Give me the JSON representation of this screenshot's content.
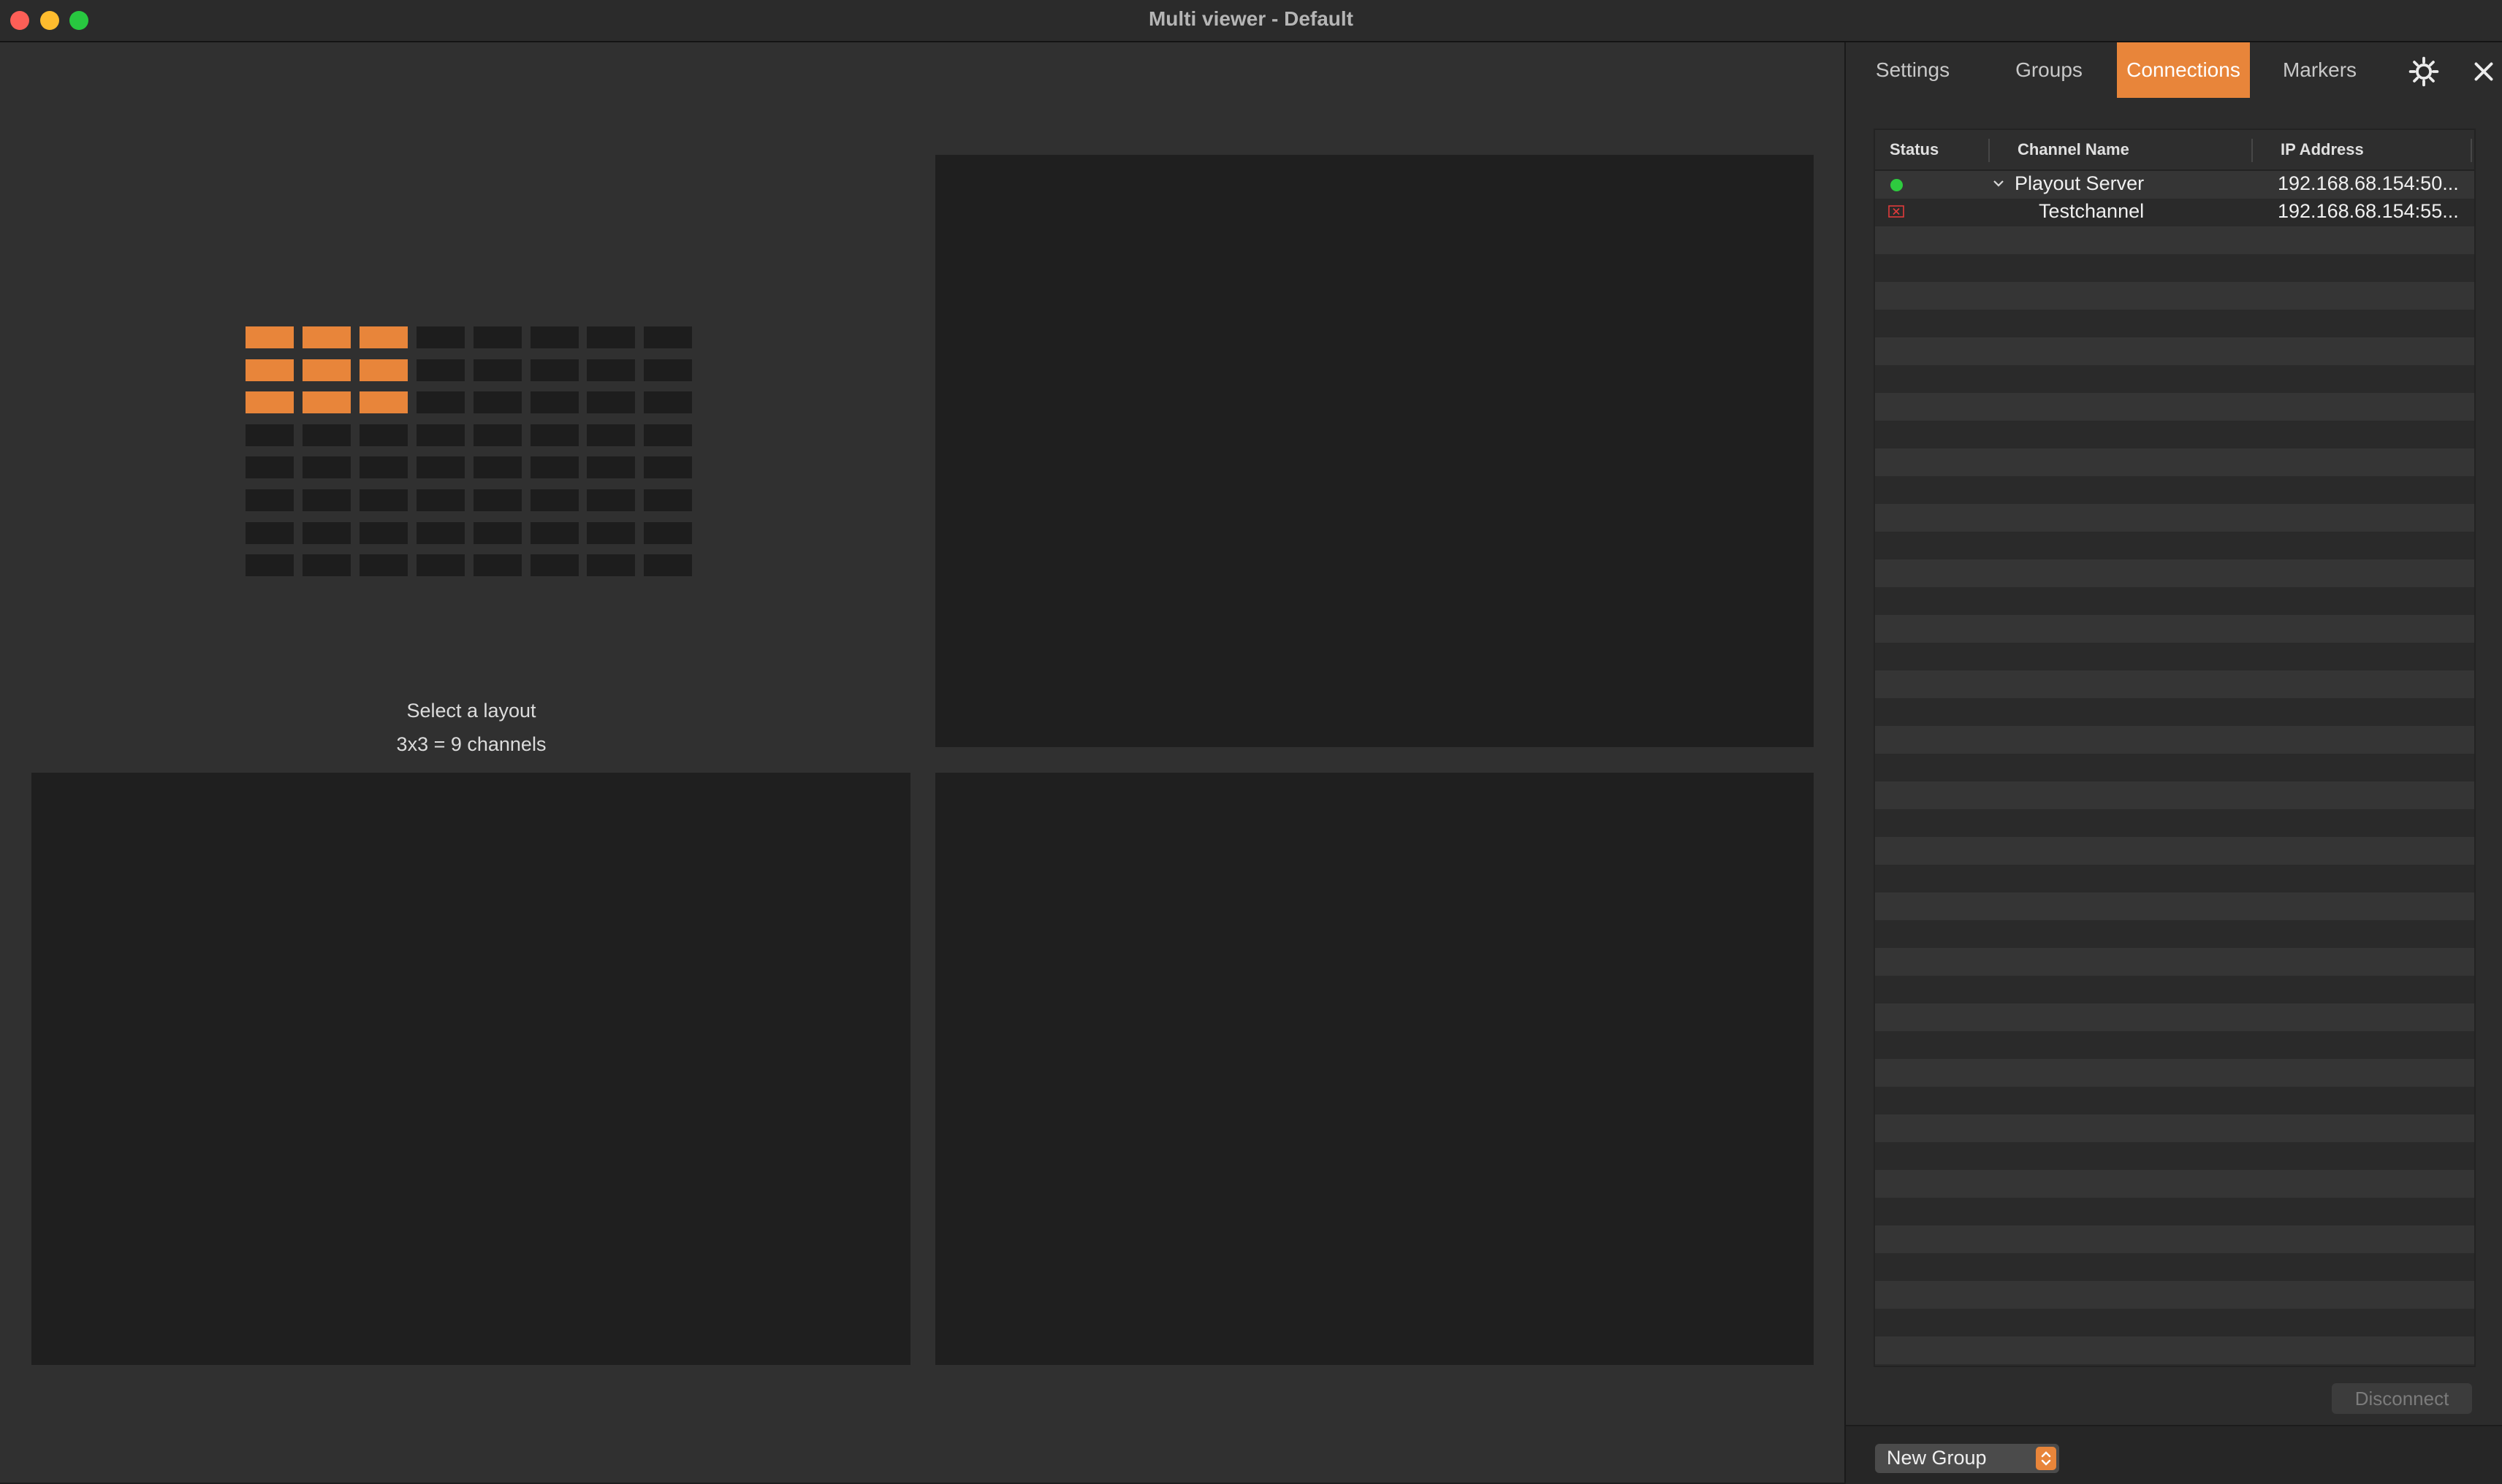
{
  "window": {
    "title": "Multi viewer - Default"
  },
  "layout_picker": {
    "prompt": "Select a layout",
    "selection": "3x3 = 9 channels",
    "grid_columns": 8,
    "grid_rows": 8,
    "selected_columns": 3,
    "selected_rows": 3,
    "accent_color": "#e8853a"
  },
  "panel": {
    "tabs": [
      {
        "label": "Settings"
      },
      {
        "label": "Groups"
      },
      {
        "label": "Connections",
        "active": true
      },
      {
        "label": "Markers"
      }
    ],
    "icons": {
      "settings": "gear-icon",
      "close": "close-icon"
    },
    "table": {
      "columns": [
        "Status",
        "Channel Name",
        "IP Address"
      ],
      "rows": [
        {
          "status": "connected",
          "status_color": "#2ecb3f",
          "name": "Playout Server",
          "ip": "192.168.68.154:50...",
          "expanded": true
        },
        {
          "status": "error",
          "status_color": "#e03b3b",
          "name": "Testchannel",
          "ip": "192.168.68.154:55..."
        }
      ]
    },
    "disconnect_label": "Disconnect",
    "group_select": {
      "value": "New Group"
    }
  }
}
